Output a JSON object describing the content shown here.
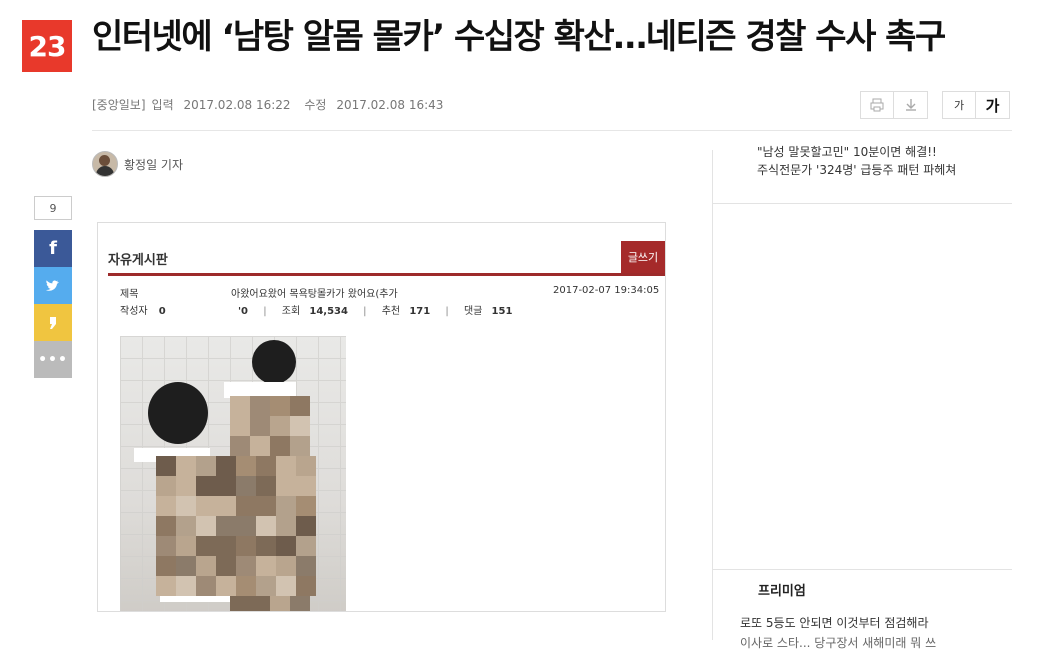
{
  "rank": "23",
  "headline": "인터넷에 ‘남탕 알몸 몰카’ 수십장 확산…네티즌 경찰 수사 촉구",
  "meta": {
    "source": "[중앙일보]",
    "input_label": "입력",
    "input_time": "2017.02.08 16:22",
    "edit_label": "수정",
    "edit_time": "2017.02.08 16:43"
  },
  "toolbar": {
    "print_icon": "printer-icon",
    "download_icon": "download-icon",
    "font_small": "가",
    "font_large": "가"
  },
  "author": {
    "name": "황정일 기자"
  },
  "share": {
    "count": "9",
    "facebook": "f",
    "twitter_icon": "twitter-bird-icon",
    "kakao_icon": "kakaostory-icon",
    "more": "•••"
  },
  "board": {
    "title": "자유게시판",
    "write_button": "글쓰기",
    "subject_label": "제목",
    "subject_value": "아왔어요왔어 목욕탕몰카가 왔어요(추가",
    "date": "2017-02-07 19:34:05",
    "author_label": "작성자",
    "author_value": "0",
    "author_tail": "'0",
    "views_label": "조회",
    "views": "14,534",
    "recommend_label": "추천",
    "recommend": "171",
    "comments_label": "댓글",
    "comments": "151"
  },
  "sidebar": {
    "ad_line1": "\"남성 말못할고민\"   10분이면 해결!!",
    "ad_line2": "주식전문가 '324명' 급등주 패턴 파헤쳐",
    "premium_title": "프리미엄",
    "premium_item1": "로또 5등도 안되면 이것부터 점검해라",
    "premium_item2": "이사로 스타... 당구장서 새해미래 뭐 쓰"
  },
  "colors": {
    "badge": "#e8392b",
    "facebook": "#3b5998",
    "twitter": "#55acee",
    "kakao": "#f0c540",
    "board_accent": "#a52a2a"
  }
}
